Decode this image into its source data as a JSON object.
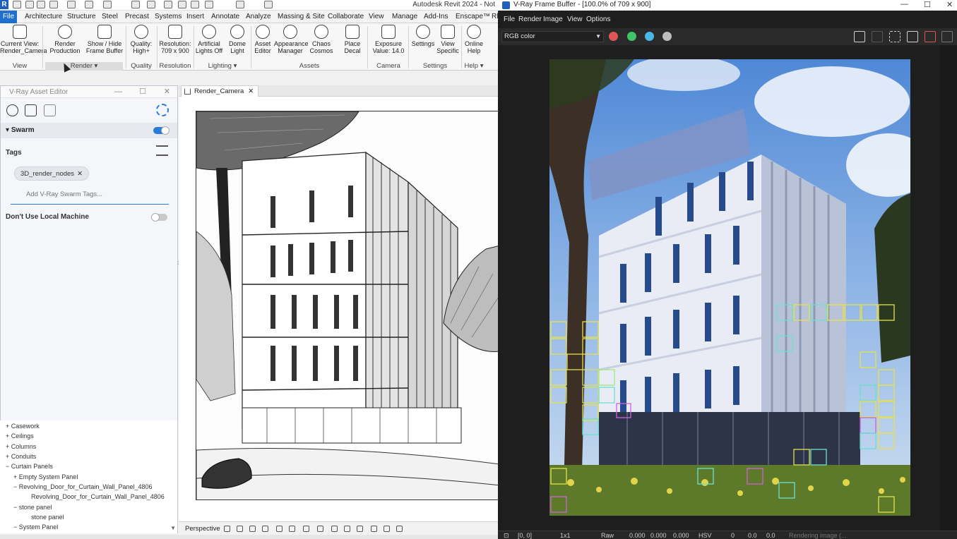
{
  "revit": {
    "title": "Autodesk Revit 2024 - Not",
    "tabs": [
      "File",
      "Architecture",
      "Structure",
      "Steel",
      "Precast",
      "Systems",
      "Insert",
      "Annotate",
      "Analyze",
      "Massing & Site",
      "Collaborate",
      "View",
      "Manage",
      "Add-Ins",
      "Enscape™",
      "Rl"
    ],
    "ribbon": {
      "buttons": [
        {
          "line1": "Current View:",
          "line2": "Render_Camera"
        },
        {
          "line1": "Render",
          "line2": "Production"
        },
        {
          "line1": "Show / Hide",
          "line2": "Frame Buffer"
        },
        {
          "line1": "Quality:",
          "line2": "High+"
        },
        {
          "line1": "Resolution:",
          "line2": "709 x 900"
        },
        {
          "line1": "Artificial",
          "line2": "Lights Off"
        },
        {
          "line1": "Dome",
          "line2": "Light"
        },
        {
          "line1": "Asset",
          "line2": "Editor"
        },
        {
          "line1": "Appearance",
          "line2": "Manager"
        },
        {
          "line1": "Chaos",
          "line2": "Cosmos"
        },
        {
          "line1": "Place",
          "line2": "Decal"
        },
        {
          "line1": "Exposure",
          "line2": "Value: 14.0"
        },
        {
          "line1": "Settings",
          "line2": ""
        },
        {
          "line1": "View",
          "line2": "Specific"
        },
        {
          "line1": "Online",
          "line2": "Help"
        }
      ],
      "groups": [
        "View",
        "Render ▾",
        "Quality",
        "Resolution",
        "Lighting ▾",
        "Assets",
        "Camera",
        "Settings",
        "Help ▾"
      ]
    },
    "asset_editor": {
      "title": "V-Ray Asset Editor",
      "section": "Swarm",
      "swarm_enabled": true,
      "tags_label": "Tags",
      "tag_chip": "3D_render_nodes",
      "tag_input_placeholder": "Add V-Ray Swarm Tags...",
      "dont_use_local_label": "Don't Use Local Machine",
      "dont_use_local_enabled": false
    },
    "project_browser": {
      "items": [
        {
          "label": "Casework",
          "prefix": "+"
        },
        {
          "label": "Ceilings",
          "prefix": "+"
        },
        {
          "label": "Columns",
          "prefix": "+"
        },
        {
          "label": "Conduits",
          "prefix": "+"
        },
        {
          "label": "Curtain Panels",
          "prefix": "−"
        },
        {
          "label": "Empty System Panel",
          "prefix": "+"
        },
        {
          "label": "Revolving_Door_for_Curtain_Wall_Panel_4806",
          "prefix": "−"
        },
        {
          "label": "Revolving_Door_for_Curtain_Wall_Panel_4806",
          "prefix": ""
        },
        {
          "label": "stone panel",
          "prefix": "−"
        },
        {
          "label": "stone panel",
          "prefix": ""
        },
        {
          "label": "System Panel",
          "prefix": "−"
        }
      ]
    },
    "view_tab": "Render_Camera",
    "view_control_label": "Perspective"
  },
  "vfb": {
    "title": "V-Ray Frame Buffer - [100.0% of 709 x 900]",
    "menu": [
      "File",
      "Render",
      "Image",
      "View",
      "Options"
    ],
    "channel": "RGB color",
    "colors": {
      "red": "#e05555",
      "green": "#3fc46a",
      "blue": "#4ab8e6",
      "bg": "#1e1e1e",
      "accent": "#1f6fd1"
    },
    "status": {
      "coords": "[0, 0]",
      "zoom": "1x1",
      "raw_label": "Raw",
      "v1": "0.000",
      "v2": "0.000",
      "v3": "0.000",
      "mode": "HSV",
      "h": "0",
      "s": "0.0",
      "v": "0.0",
      "message": "Rendering image (..."
    }
  }
}
